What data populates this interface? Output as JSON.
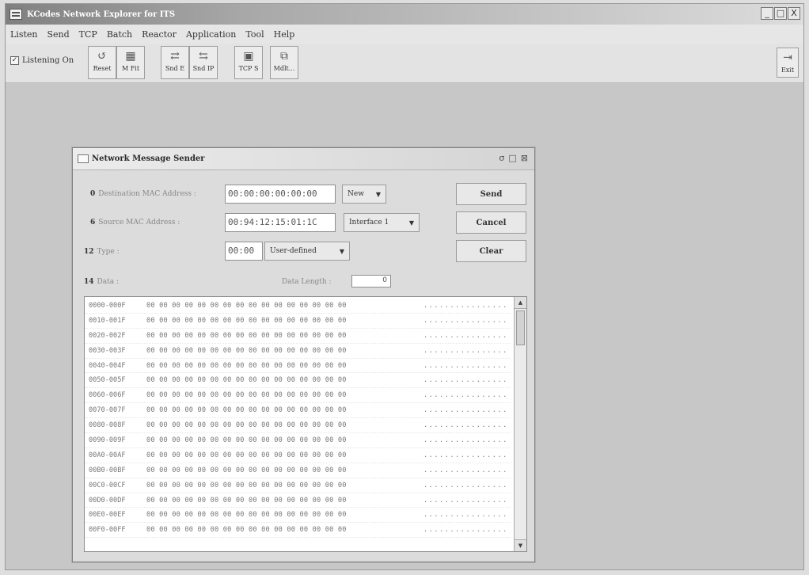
{
  "window": {
    "title": "KCodes Network Explorer for ITS",
    "controls": [
      "_",
      "□",
      "X"
    ]
  },
  "menu": [
    "Listen",
    "Send",
    "TCP",
    "Batch",
    "Reactor",
    "Application",
    "Tool",
    "Help"
  ],
  "toolbar": {
    "listening_label": "Listening On",
    "listening_checked": "✓",
    "buttons": [
      {
        "label": "Reset",
        "icon": "reset-icon"
      },
      {
        "label": "M Fit",
        "icon": "filter-icon"
      },
      {
        "label": "Snd E",
        "icon": "send-ethernet-icon"
      },
      {
        "label": "Snd IP",
        "icon": "send-ip-icon"
      },
      {
        "label": "TCP S",
        "icon": "tcp-icon"
      },
      {
        "label": "Mdlt...",
        "icon": "module-icon"
      }
    ],
    "exit_label": "Exit"
  },
  "dialog": {
    "title": "Network Message Sender",
    "controls": [
      "σ",
      "□",
      "⊠"
    ],
    "dest_mac": {
      "num": "0",
      "label": "Destination MAC Address :",
      "value": "00:00:00:00:00:00",
      "option": "New"
    },
    "src_mac": {
      "num": "6",
      "label": "Source MAC Address :",
      "value": "00:94:12:15:01:1C",
      "option": "Interface 1"
    },
    "type": {
      "num": "12",
      "label": "Type :",
      "value": "00:00",
      "option": "User-defined"
    },
    "data": {
      "num": "14",
      "label": "Data :",
      "length_label": "Data Length :",
      "length_value": "0"
    },
    "buttons": {
      "send": "Send",
      "cancel": "Cancel",
      "clear": "Clear"
    },
    "hex_rows": [
      {
        "addr": "0000-000F",
        "bytes": "00 00 00 00 00 00 00 00 00 00 00 00 00 00 00 00",
        "ascii": "................"
      },
      {
        "addr": "0010-001F",
        "bytes": "00 00 00 00 00 00 00 00 00 00 00 00 00 00 00 00",
        "ascii": "................"
      },
      {
        "addr": "0020-002F",
        "bytes": "00 00 00 00 00 00 00 00 00 00 00 00 00 00 00 00",
        "ascii": "................"
      },
      {
        "addr": "0030-003F",
        "bytes": "00 00 00 00 00 00 00 00 00 00 00 00 00 00 00 00",
        "ascii": "................"
      },
      {
        "addr": "0040-004F",
        "bytes": "00 00 00 00 00 00 00 00 00 00 00 00 00 00 00 00",
        "ascii": "................"
      },
      {
        "addr": "0050-005F",
        "bytes": "00 00 00 00 00 00 00 00 00 00 00 00 00 00 00 00",
        "ascii": "................"
      },
      {
        "addr": "0060-006F",
        "bytes": "00 00 00 00 00 00 00 00 00 00 00 00 00 00 00 00",
        "ascii": "................"
      },
      {
        "addr": "0070-007F",
        "bytes": "00 00 00 00 00 00 00 00 00 00 00 00 00 00 00 00",
        "ascii": "................"
      },
      {
        "addr": "0080-008F",
        "bytes": "00 00 00 00 00 00 00 00 00 00 00 00 00 00 00 00",
        "ascii": "................"
      },
      {
        "addr": "0090-009F",
        "bytes": "00 00 00 00 00 00 00 00 00 00 00 00 00 00 00 00",
        "ascii": "................"
      },
      {
        "addr": "00A0-00AF",
        "bytes": "00 00 00 00 00 00 00 00 00 00 00 00 00 00 00 00",
        "ascii": "................"
      },
      {
        "addr": "00B0-00BF",
        "bytes": "00 00 00 00 00 00 00 00 00 00 00 00 00 00 00 00",
        "ascii": "................"
      },
      {
        "addr": "00C0-00CF",
        "bytes": "00 00 00 00 00 00 00 00 00 00 00 00 00 00 00 00",
        "ascii": "................"
      },
      {
        "addr": "00D0-00DF",
        "bytes": "00 00 00 00 00 00 00 00 00 00 00 00 00 00 00 00",
        "ascii": "................"
      },
      {
        "addr": "00E0-00EF",
        "bytes": "00 00 00 00 00 00 00 00 00 00 00 00 00 00 00 00",
        "ascii": "................"
      },
      {
        "addr": "00F0-00FF",
        "bytes": "00 00 00 00 00 00 00 00 00 00 00 00 00 00 00 00",
        "ascii": "................"
      }
    ]
  }
}
